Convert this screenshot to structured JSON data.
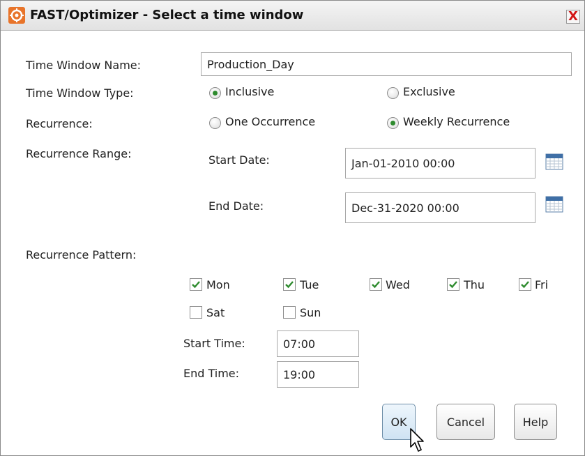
{
  "window": {
    "title": "FAST/Optimizer - Select a time window",
    "close_glyph": "X",
    "app_icon": "orange-gear-icon"
  },
  "form": {
    "name_label": "Time Window Name:",
    "name_value": "Production_Day",
    "type_label": "Time Window Type:",
    "type_options": [
      {
        "label": "Inclusive",
        "selected": true
      },
      {
        "label": "Exclusive",
        "selected": false
      }
    ],
    "recurrence_label": "Recurrence:",
    "recurrence_options": [
      {
        "label": "One Occurrence",
        "selected": false
      },
      {
        "label": "Weekly Recurrence",
        "selected": true
      }
    ],
    "range_label": "Recurrence Range:",
    "start_date_label": "Start Date:",
    "start_date_value": "Jan-01-2010 00:00",
    "end_date_label": "End Date:",
    "end_date_value": "Dec-31-2020 00:00",
    "pattern_label": "Recurrence Pattern:",
    "days": [
      {
        "label": "Mon",
        "checked": true
      },
      {
        "label": "Tue",
        "checked": true
      },
      {
        "label": "Wed",
        "checked": true
      },
      {
        "label": "Thu",
        "checked": true
      },
      {
        "label": "Fri",
        "checked": true
      },
      {
        "label": "Sat",
        "checked": false
      },
      {
        "label": "Sun",
        "checked": false
      }
    ],
    "start_time_label": "Start Time:",
    "start_time_value": "07:00",
    "end_time_label": "End Time:",
    "end_time_value": "19:00"
  },
  "buttons": {
    "ok": "OK",
    "cancel": "Cancel",
    "help": "Help"
  },
  "colors": {
    "check_green": "#2e8b2e",
    "close_red": "#d21515",
    "app_icon_orange": "#e8742a"
  }
}
